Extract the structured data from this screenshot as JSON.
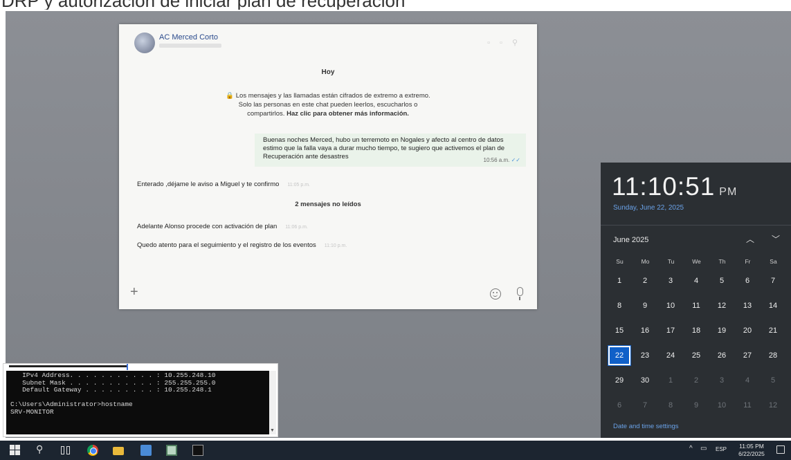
{
  "page_heading": "DRP y autorización de iniciar plan de recuperación",
  "chat": {
    "contact_name": "AC Merced Corto",
    "day_label": "Hoy",
    "encryption_notice_line1": "🔒 Los mensajes y las llamadas están cifrados de extremo a extremo.",
    "encryption_notice_line2": "Solo las personas en este chat pueden leerlos, escucharlos o",
    "encryption_notice_line3": "compartirlos.",
    "encryption_notice_link": "Haz clic para obtener más información.",
    "outgoing_message": {
      "text": "Buenas noches Merced, hubo un terremoto en Nogales y afecto al centro de datos estimo que la falla vaya a durar mucho tiempo, te sugiero que activemos el plan de Recuperación ante desastres",
      "time": "10:56 a.m.",
      "ticks": "✓✓"
    },
    "incoming_1": {
      "text": "Enterado ,déjame le  aviso a Miguel y te confirmo",
      "time": "11:05 p.m."
    },
    "unread_label": "2 mensajes no leídos",
    "incoming_2": {
      "text": "Adelante Alonso procede con activación de plan",
      "time": "11:06 p.m."
    },
    "incoming_3": {
      "text": "Quedo atento para el seguimiento y el registro de los eventos",
      "time": "11:10 p.m."
    },
    "plus_glyph": "+"
  },
  "terminal": {
    "output": "   IPv4 Address. . . . . . . . . . . : 10.255.248.10\n   Subnet Mask . . . . . . . . . . . : 255.255.255.0\n   Default Gateway . . . . . . . . . : 10.255.248.1\n\nC:\\Users\\Administrator>hostname\nSRV-MONITOR"
  },
  "clock": {
    "time": "11:10:51",
    "ampm": "PM",
    "date": "Sunday, June 22, 2025",
    "month_label": "June 2025",
    "nav_up": "︿",
    "nav_down": "﹀",
    "weekdays": [
      "Su",
      "Mo",
      "Tu",
      "We",
      "Th",
      "Fr",
      "Sa"
    ],
    "weeks": [
      [
        "1",
        "2",
        "3",
        "4",
        "5",
        "6",
        "7"
      ],
      [
        "8",
        "9",
        "10",
        "11",
        "12",
        "13",
        "14"
      ],
      [
        "15",
        "16",
        "17",
        "18",
        "19",
        "20",
        "21"
      ],
      [
        "22",
        "23",
        "24",
        "25",
        "26",
        "27",
        "28"
      ],
      [
        "29",
        "30",
        "1",
        "2",
        "3",
        "4",
        "5"
      ],
      [
        "6",
        "7",
        "8",
        "9",
        "10",
        "11",
        "12"
      ]
    ],
    "selected_day": "22",
    "settings_link": "Date and time settings"
  },
  "taskbar": {
    "tray_chevron": "^",
    "language": "ESP",
    "time": "11:05 PM",
    "date": "6/22/2025"
  },
  "colors": {
    "accent_blue": "#1060c8",
    "link_blue": "#6aa2e8",
    "taskbar": "#1c2530",
    "flyout": "#2b2f33"
  }
}
